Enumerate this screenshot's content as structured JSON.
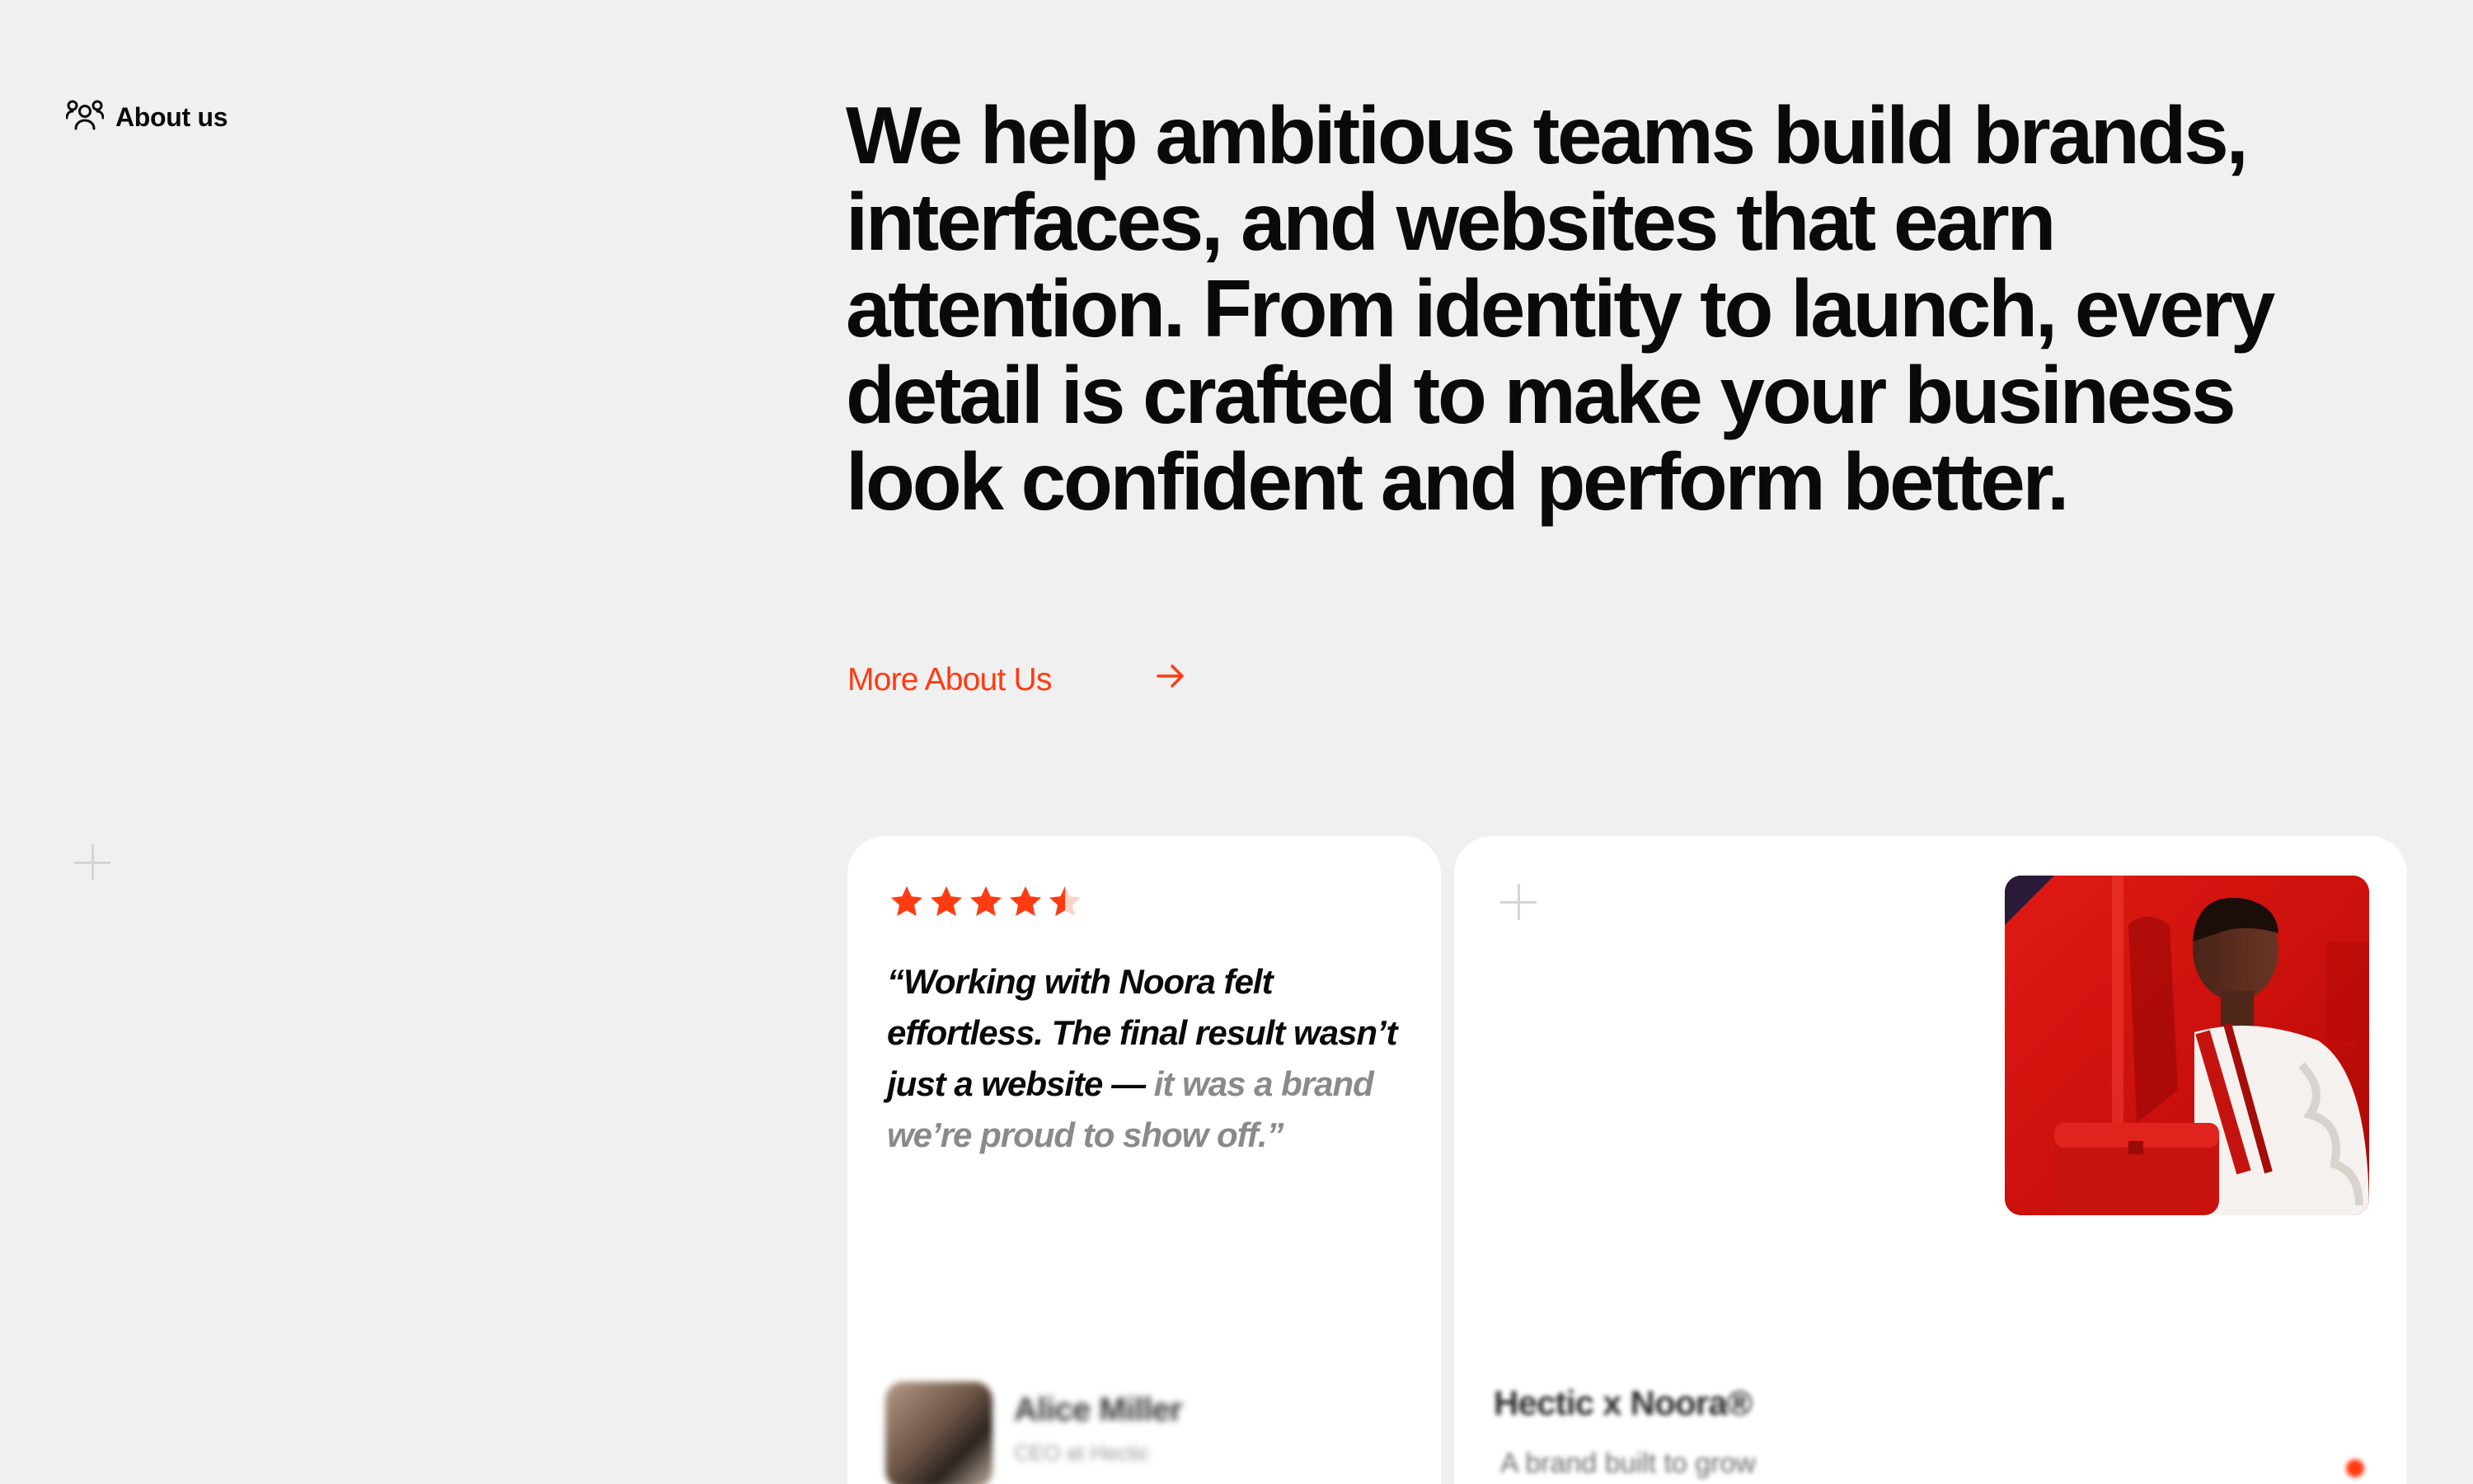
{
  "section": {
    "label": "About us",
    "icon": "team-icon"
  },
  "headline": "We help ambitious teams build brands, interfaces, and websites that earn attention. From identity to launch, every detail is crafted to make your business look confident and perform better.",
  "cta": {
    "label": "More About Us",
    "icon": "arrow-right-icon",
    "color": "#ff3b12"
  },
  "testimonial": {
    "rating": 4.5,
    "rating_max": 5,
    "quote_strong": "“Working with Noora felt effortless. The final result wasn’t just a website — ",
    "quote_muted": "it was a brand we’re proud to show off.”",
    "author_name": "Alice Miller",
    "author_role": "CEO at Hectic"
  },
  "project": {
    "title": "Hectic x Noora®",
    "subtitle": "A brand built to grow",
    "photo": "woman-with-red-bag-image"
  },
  "colors": {
    "accent": "#ff3b12",
    "background": "#f0f0f0",
    "card": "#ffffff",
    "text": "#0a0a0a",
    "muted": "#8a8a8a"
  }
}
